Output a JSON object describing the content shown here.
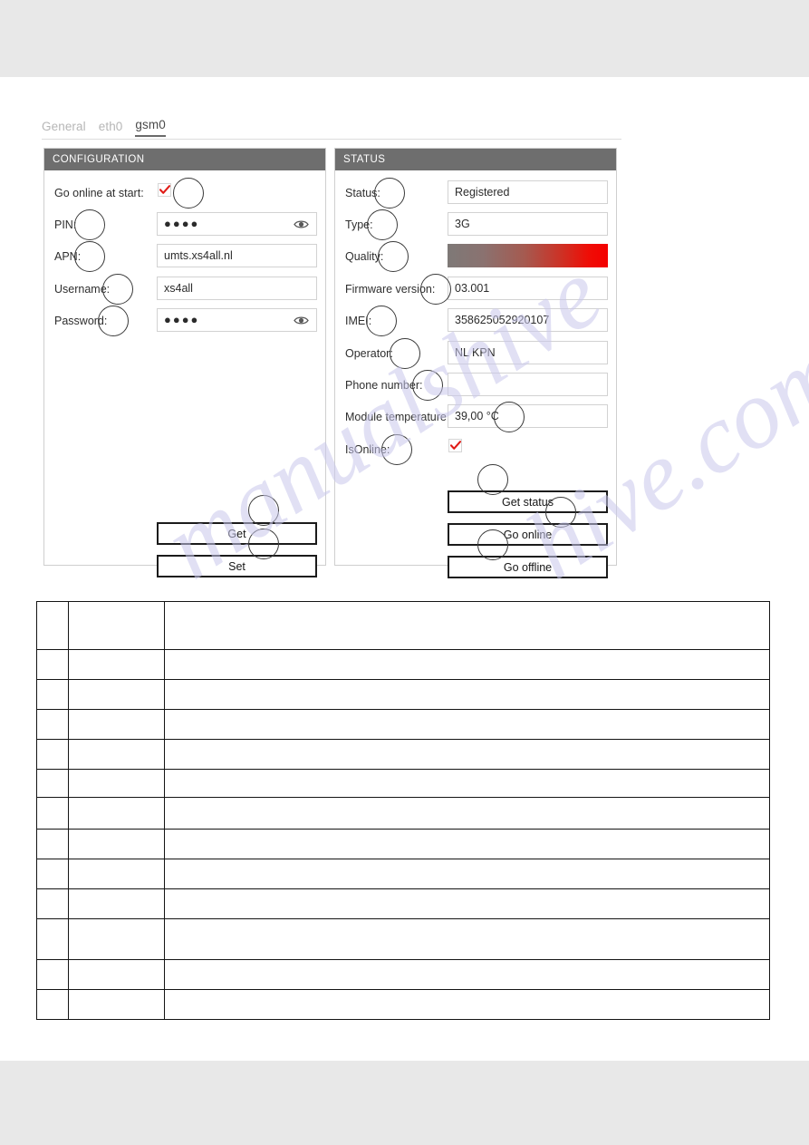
{
  "page": {
    "background_band_color": "#e8e8e8",
    "watermark_left": "manualshive",
    "watermark_right": "hive.com"
  },
  "tabs": {
    "items": [
      {
        "label": "General",
        "active": false
      },
      {
        "label": "eth0",
        "active": false
      },
      {
        "label": "gsm0",
        "active": true
      }
    ]
  },
  "configuration": {
    "header": "CONFIGURATION",
    "fields": {
      "go_online_at_start": {
        "label": "Go online at start:",
        "checked": true
      },
      "pin": {
        "label": "PIN:",
        "value": "●●●●",
        "masked": true
      },
      "apn": {
        "label": "APN:",
        "value": "umts.xs4all.nl"
      },
      "username": {
        "label": "Username:",
        "value": "xs4all"
      },
      "password": {
        "label": "Password:",
        "value": "●●●●",
        "masked": true
      }
    },
    "buttons": {
      "get": "Get",
      "set": "Set"
    }
  },
  "status": {
    "header": "STATUS",
    "fields": {
      "status": {
        "label": "Status:",
        "value": "Registered"
      },
      "type": {
        "label": "Type:",
        "value": "3G"
      },
      "quality": {
        "label": "Quality:",
        "value": "",
        "gradient_from": "#7e7977",
        "gradient_to": "#f40000"
      },
      "firmware_version": {
        "label": "Firmware version:",
        "value": "03.001"
      },
      "imei": {
        "label": "IMEI:",
        "value": "358625052920107"
      },
      "operator": {
        "label": "Operator:",
        "value": "NL KPN"
      },
      "phone_number": {
        "label": "Phone number:",
        "value": ""
      },
      "module_temperature": {
        "label": "Module temperature:",
        "value": "39,00 °C"
      },
      "is_online": {
        "label": "IsOnline:",
        "checked": true
      }
    },
    "buttons": {
      "get_status": "Get status",
      "go_online": "Go online",
      "go_offline": "Go offline"
    }
  },
  "table": {
    "columns": [
      "",
      "",
      ""
    ],
    "rows": [
      [
        "",
        "",
        ""
      ],
      [
        "",
        "",
        ""
      ],
      [
        "",
        "",
        ""
      ],
      [
        "",
        "",
        ""
      ],
      [
        "",
        "",
        ""
      ],
      [
        "",
        "",
        ""
      ],
      [
        "",
        "",
        ""
      ],
      [
        "",
        "",
        ""
      ],
      [
        "",
        "",
        ""
      ],
      [
        "",
        "",
        ""
      ],
      [
        "",
        "",
        ""
      ],
      [
        "",
        "",
        ""
      ],
      [
        "",
        "",
        ""
      ]
    ]
  },
  "colors": {
    "panel_header": "#6e6e6e",
    "checkmark_red": "#e01b16",
    "tab_active": "#4a4a4a",
    "tab_inactive": "#b6b6b6"
  }
}
